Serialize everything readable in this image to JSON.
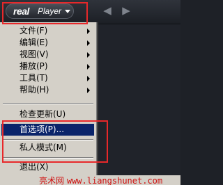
{
  "app": {
    "logo_brand": "real",
    "logo_product": "Player"
  },
  "nav": {
    "back_icon": "arrow-left-icon",
    "forward_icon": "arrow-right-icon"
  },
  "menu": {
    "items": [
      {
        "label": "文件(F)",
        "submenu": true
      },
      {
        "label": "编辑(E)",
        "submenu": true
      },
      {
        "label": "视图(V)",
        "submenu": true
      },
      {
        "label": "播放(P)",
        "submenu": true
      },
      {
        "label": "工具(T)",
        "submenu": true
      },
      {
        "label": "帮助(H)",
        "submenu": true
      },
      {
        "label": "检查更新(U)",
        "submenu": false
      },
      {
        "label": "首选项(P)...",
        "submenu": false,
        "selected": true
      },
      {
        "label": "私人模式(M)",
        "submenu": false
      },
      {
        "label": "退出(X)",
        "submenu": false
      }
    ]
  },
  "watermark": {
    "site_name": "亮术网",
    "site_url": "www.liangshunet.com"
  },
  "colors": {
    "highlight": "#0a246a",
    "annotation_red": "#e8282a",
    "menu_bg": "#d4d0c8"
  }
}
